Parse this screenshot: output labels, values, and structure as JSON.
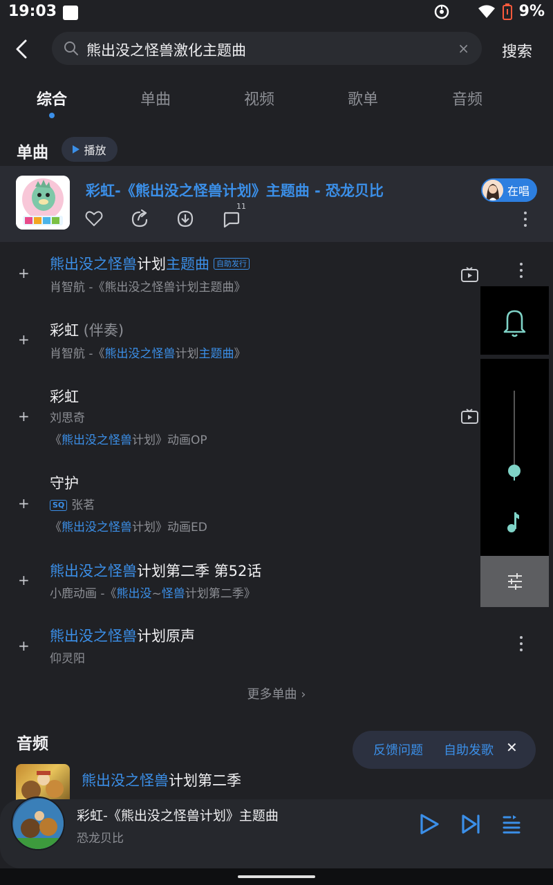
{
  "status_bar": {
    "time": "19:03",
    "battery": "9%"
  },
  "search": {
    "query": "熊出没之怪兽激化主题曲",
    "clear_icon": "×",
    "submit_label": "搜索"
  },
  "tabs": [
    {
      "label": "综合",
      "active": true
    },
    {
      "label": "单曲",
      "active": false
    },
    {
      "label": "视频",
      "active": false
    },
    {
      "label": "歌单",
      "active": false
    },
    {
      "label": "音频",
      "active": false
    }
  ],
  "songs_section": {
    "title": "单曲",
    "play_label": "播放",
    "more_label": "更多单曲 ›"
  },
  "featured": {
    "title_prefix": "彩虹-《熊出没之怪兽计划》主题曲 - 恐龙贝比",
    "sing_label": "在唱",
    "comment_count": "11",
    "cover_caption": "恐龙贝比"
  },
  "songs": [
    {
      "title_hl1": "熊出没之怪兽",
      "title_mid": "计划",
      "title_hl2": "主题曲",
      "tag": "自助发行",
      "subtitle": "肖智航 -《熊出没之怪兽计划主题曲》"
    },
    {
      "title_main": "彩虹",
      "title_extra": " (伴奏)",
      "sub_prefix": "肖智航 -《",
      "sub_hl1": "熊出没之怪兽",
      "sub_mid": "计划",
      "sub_hl2": "主题曲",
      "sub_suffix": "》"
    },
    {
      "title": "彩虹",
      "artist": "刘思奇",
      "album_prefix": "《",
      "album_hl": "熊出没之怪兽",
      "album_rest": "计划》动画OP"
    },
    {
      "title": "守护",
      "quality": "SQ",
      "artist": "张茗",
      "album_prefix": "《",
      "album_hl": "熊出没之怪兽",
      "album_rest": "计划》动画ED"
    },
    {
      "title_hl": "熊出没之怪兽",
      "title_rest": "计划第二季 第52话",
      "sub_prefix": "小鹿动画 -《",
      "sub_hl1": "熊出没",
      "sub_mid": "~",
      "sub_hl2": "怪兽",
      "sub_suffix": "计划第二季》"
    },
    {
      "title_hl": "熊出没之怪兽",
      "title_rest": "计划原声",
      "subtitle": "仰灵阳"
    }
  ],
  "audio_section": {
    "title": "音频",
    "item_title_hl": "熊出没之怪兽",
    "item_title_rest": "计划第二季"
  },
  "feedback_popup": {
    "report_label": "反馈问题",
    "publish_label": "自助发歌",
    "close_label": "✕"
  },
  "mini_player": {
    "title": "彩虹-《熊出没之怪兽计划》主题曲",
    "artist": "恐龙贝比"
  },
  "overlay": {
    "volume_level": 0.55
  },
  "colors": {
    "accent": "#3b8fe8",
    "background": "#202125",
    "overlay": "#000000"
  }
}
